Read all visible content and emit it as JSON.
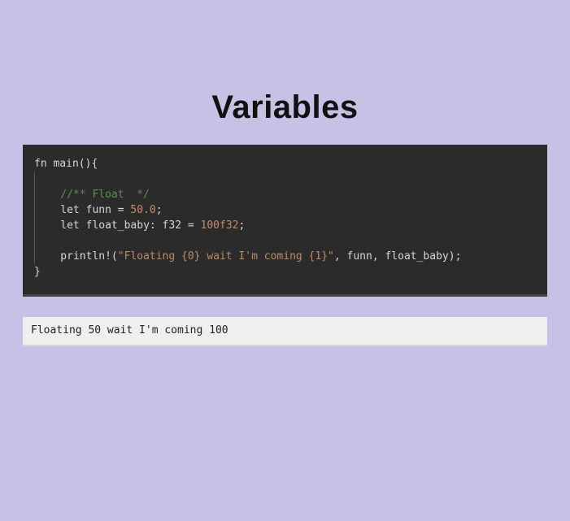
{
  "heading": "Variables",
  "code": {
    "line1_fn": "fn",
    "line1_name": " main(){",
    "blank1": "",
    "comment": "    //** Float  */",
    "let3_a": "    let",
    "let3_b": " funn = ",
    "let3_num": "50.0",
    "let3_c": ";",
    "let4_a": "    let",
    "let4_b": " float_baby: ",
    "let4_ty": "f32",
    "let4_c": " = ",
    "let4_num": "100f32",
    "let4_d": ";",
    "blank2": "",
    "print_a": "    println!",
    "print_b": "(",
    "print_str": "\"Floating {0} wait I'm coming {1}\"",
    "print_c": ", funn, float_baby);",
    "blank3": "",
    "close": "}"
  },
  "output": "Floating 50 wait I'm coming 100"
}
